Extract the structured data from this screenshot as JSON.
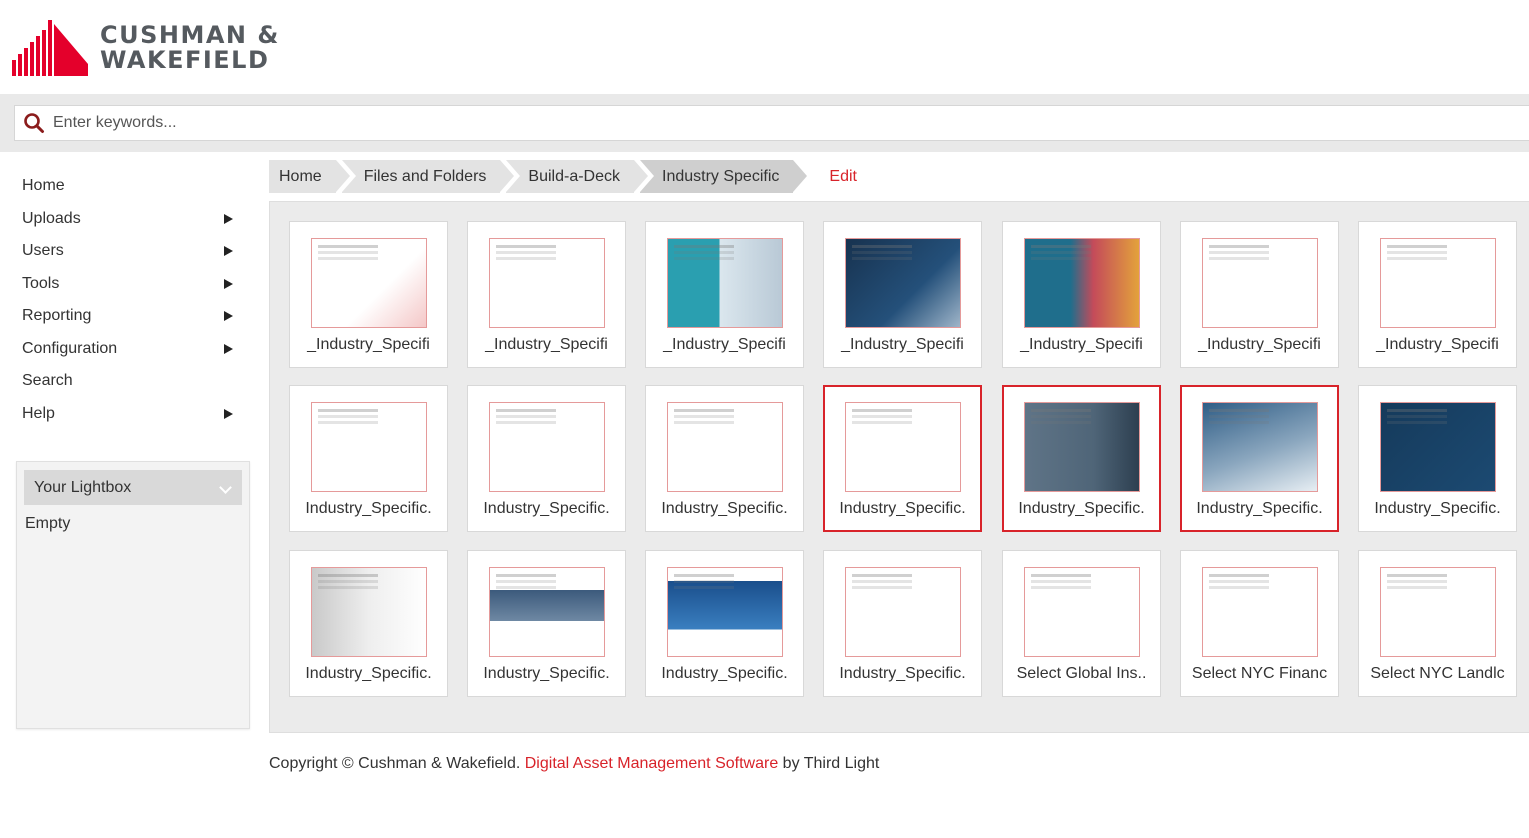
{
  "brand": {
    "line1": "CUSHMAN &",
    "line2": "WAKEFIELD",
    "color": "#e4002b"
  },
  "search": {
    "placeholder": "Enter keywords..."
  },
  "sidebar": {
    "items": [
      {
        "label": "Home",
        "has_submenu": false
      },
      {
        "label": "Uploads",
        "has_submenu": true
      },
      {
        "label": "Users",
        "has_submenu": true
      },
      {
        "label": "Tools",
        "has_submenu": true
      },
      {
        "label": "Reporting",
        "has_submenu": true
      },
      {
        "label": "Configuration",
        "has_submenu": true
      },
      {
        "label": "Search",
        "has_submenu": false
      },
      {
        "label": "Help",
        "has_submenu": true
      }
    ]
  },
  "lightbox": {
    "selected": "Your Lightbox",
    "status": "Empty"
  },
  "breadcrumb": {
    "items": [
      "Home",
      "Files and Folders",
      "Build-a-Deck",
      "Industry Specific"
    ],
    "edit_label": "Edit"
  },
  "grid": {
    "tiles": [
      {
        "label": "_Industry_Specifi",
        "selected": false
      },
      {
        "label": "_Industry_Specifi",
        "selected": false
      },
      {
        "label": "_Industry_Specifi",
        "selected": false
      },
      {
        "label": "_Industry_Specifi",
        "selected": false
      },
      {
        "label": "_Industry_Specifi",
        "selected": false
      },
      {
        "label": "_Industry_Specifi",
        "selected": false
      },
      {
        "label": "_Industry_Specifi",
        "selected": false
      },
      {
        "label": "Industry_Specific.",
        "selected": false
      },
      {
        "label": "Industry_Specific.",
        "selected": false
      },
      {
        "label": "Industry_Specific.",
        "selected": false
      },
      {
        "label": "Industry_Specific.",
        "selected": true
      },
      {
        "label": "Industry_Specific.",
        "selected": true
      },
      {
        "label": "Industry_Specific.",
        "selected": true
      },
      {
        "label": "Industry_Specific.",
        "selected": false
      },
      {
        "label": "Industry_Specific.",
        "selected": false
      },
      {
        "label": "Industry_Specific.",
        "selected": false
      },
      {
        "label": "Industry_Specific.",
        "selected": false
      },
      {
        "label": "Industry_Specific.",
        "selected": false
      },
      {
        "label": "Select Global Ins..",
        "selected": false
      },
      {
        "label": "Select NYC Financ",
        "selected": false
      },
      {
        "label": "Select NYC Landlc",
        "selected": false
      }
    ]
  },
  "footer": {
    "prefix": "Copyright © Cushman & Wakefield. ",
    "link": "Digital Asset Management Software",
    "suffix": " by Third Light"
  },
  "colors": {
    "accent": "#d8232a",
    "panel": "#ebebeb"
  }
}
